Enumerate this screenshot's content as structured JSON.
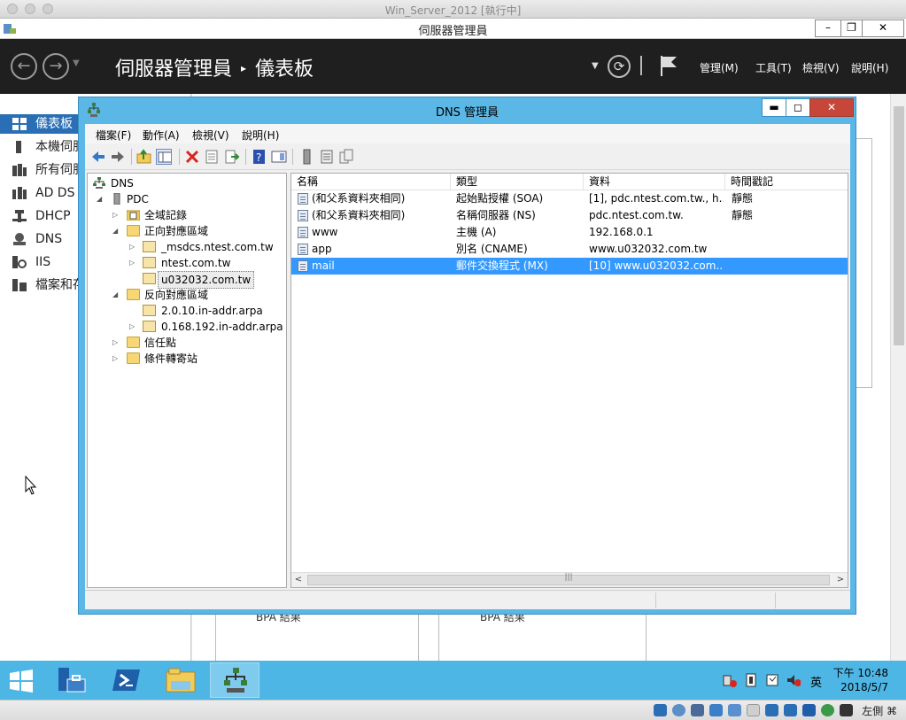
{
  "vm": {
    "title": "Win_Server_2012 [執行中]"
  },
  "server_manager": {
    "title": "伺服器管理員",
    "breadcrumb_root": "伺服器管理員",
    "breadcrumb_sep": "▸",
    "breadcrumb_page": "儀表板",
    "menus": [
      "管理(M)",
      "工具(T)",
      "檢視(V)",
      "說明(H)"
    ],
    "sidebar": [
      {
        "label": "儀表板",
        "icon": "dashboard-icon",
        "active": true
      },
      {
        "label": "本機伺服器",
        "icon": "server-icon"
      },
      {
        "label": "所有伺服器",
        "icon": "servers-icon"
      },
      {
        "label": "AD DS",
        "icon": "adds-icon"
      },
      {
        "label": "DHCP",
        "icon": "dhcp-icon"
      },
      {
        "label": "DNS",
        "icon": "dns-icon"
      },
      {
        "label": "IIS",
        "icon": "iis-icon"
      },
      {
        "label": "檔案和存放服務",
        "icon": "file-storage-icon"
      }
    ],
    "bpa_label": "BPA 結果"
  },
  "dns_manager": {
    "title": "DNS 管理員",
    "menus": [
      "檔案(F)",
      "動作(A)",
      "檢視(V)",
      "說明(H)"
    ],
    "tree": {
      "root": "DNS",
      "server": "PDC",
      "global_logs": "全域記錄",
      "forward_zones": "正向對應區域",
      "forward_children": [
        "_msdcs.ntest.com.tw",
        "ntest.com.tw",
        "u032032.com.tw"
      ],
      "reverse_zones": "反向對應區域",
      "reverse_children": [
        "2.0.10.in-addr.arpa",
        "0.168.192.in-addr.arpa"
      ],
      "trust_points": "信任點",
      "conditional_forwarders": "條件轉寄站"
    },
    "columns": [
      "名稱",
      "類型",
      "資料",
      "時間戳記"
    ],
    "records": [
      {
        "name": "(和父系資料夾相同)",
        "type": "起始點授權 (SOA)",
        "data": "[1], pdc.ntest.com.tw., h...",
        "timestamp": "靜態"
      },
      {
        "name": "(和父系資料夾相同)",
        "type": "名稱伺服器 (NS)",
        "data": "pdc.ntest.com.tw.",
        "timestamp": "靜態"
      },
      {
        "name": "www",
        "type": "主機 (A)",
        "data": "192.168.0.1",
        "timestamp": ""
      },
      {
        "name": "app",
        "type": "別名 (CNAME)",
        "data": "www.u032032.com.tw",
        "timestamp": ""
      },
      {
        "name": "mail",
        "type": "郵件交換程式 (MX)",
        "data": "[10]  www.u032032.com....",
        "timestamp": ""
      }
    ],
    "scroll_grip": "|||"
  },
  "taskbar": {
    "time": "下午 10:48",
    "date": "2018/5/7",
    "ime": "英"
  },
  "vbox": {
    "host_key": "左側 ⌘"
  },
  "colors": {
    "taskbar": "#4db6e4",
    "dns_frame": "#5bb8e6",
    "selection": "#3399ff",
    "sm_header": "#1f1f1f",
    "sidebar_active": "#2a6fb5"
  }
}
